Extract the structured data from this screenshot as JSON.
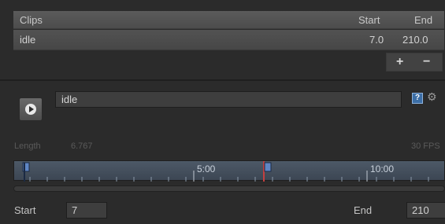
{
  "clips": {
    "headers": {
      "name": "Clips",
      "start": "Start",
      "end": "End"
    },
    "rows": [
      {
        "name": "idle",
        "start": "7.0",
        "end": "210.0"
      }
    ],
    "add_label": "+",
    "remove_label": "−"
  },
  "clip_detail": {
    "name_value": "idle",
    "help_icon_glyph": "?",
    "gear_icon_glyph": "⚙"
  },
  "stats": {
    "length_label": "Length",
    "length_value": "6.767",
    "fps_label": "30 FPS"
  },
  "timeline": {
    "tick_labels": [
      "5:00",
      "10:00"
    ],
    "track_color": "#4a5563",
    "marker_color_start": "#4b6fa6",
    "marker_color_current": "#b53a3a"
  },
  "range": {
    "start_label": "Start",
    "start_value": "7",
    "end_label": "End",
    "end_value": "210"
  }
}
